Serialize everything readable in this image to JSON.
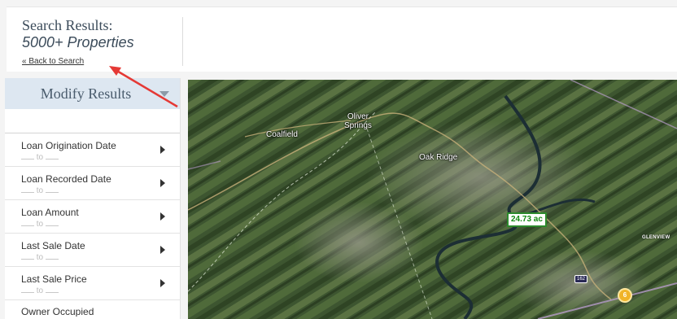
{
  "header": {
    "title": "Search Results:",
    "subtitle": "5000+ Properties",
    "back_link": "« Back to Search"
  },
  "sidebar": {
    "modify_label": "Modify Results",
    "filters": [
      {
        "label": "Loan Origination Date",
        "range_sep": "to"
      },
      {
        "label": "Loan Recorded Date",
        "range_sep": "to"
      },
      {
        "label": "Loan Amount",
        "range_sep": "to"
      },
      {
        "label": "Last Sale Date",
        "range_sep": "to"
      },
      {
        "label": "Last Sale Price",
        "range_sep": "to"
      }
    ],
    "partial_filter_label": "Owner Occupied"
  },
  "map": {
    "places": {
      "coalfield": "Coalfield",
      "oliver_springs": "Oliver\nSprings",
      "oak_ridge": "Oak Ridge",
      "glenview": "GLENVIEW"
    },
    "acreage_badge": "24.73 ac",
    "route_shield": "162",
    "cluster_count": "6"
  },
  "colors": {
    "header_bg": "#ffffff",
    "modify_bar_bg": "#dde7f1",
    "acreage_green": "#118811",
    "annotation_red": "#e53935",
    "cluster_yellow": "#f0b429"
  }
}
